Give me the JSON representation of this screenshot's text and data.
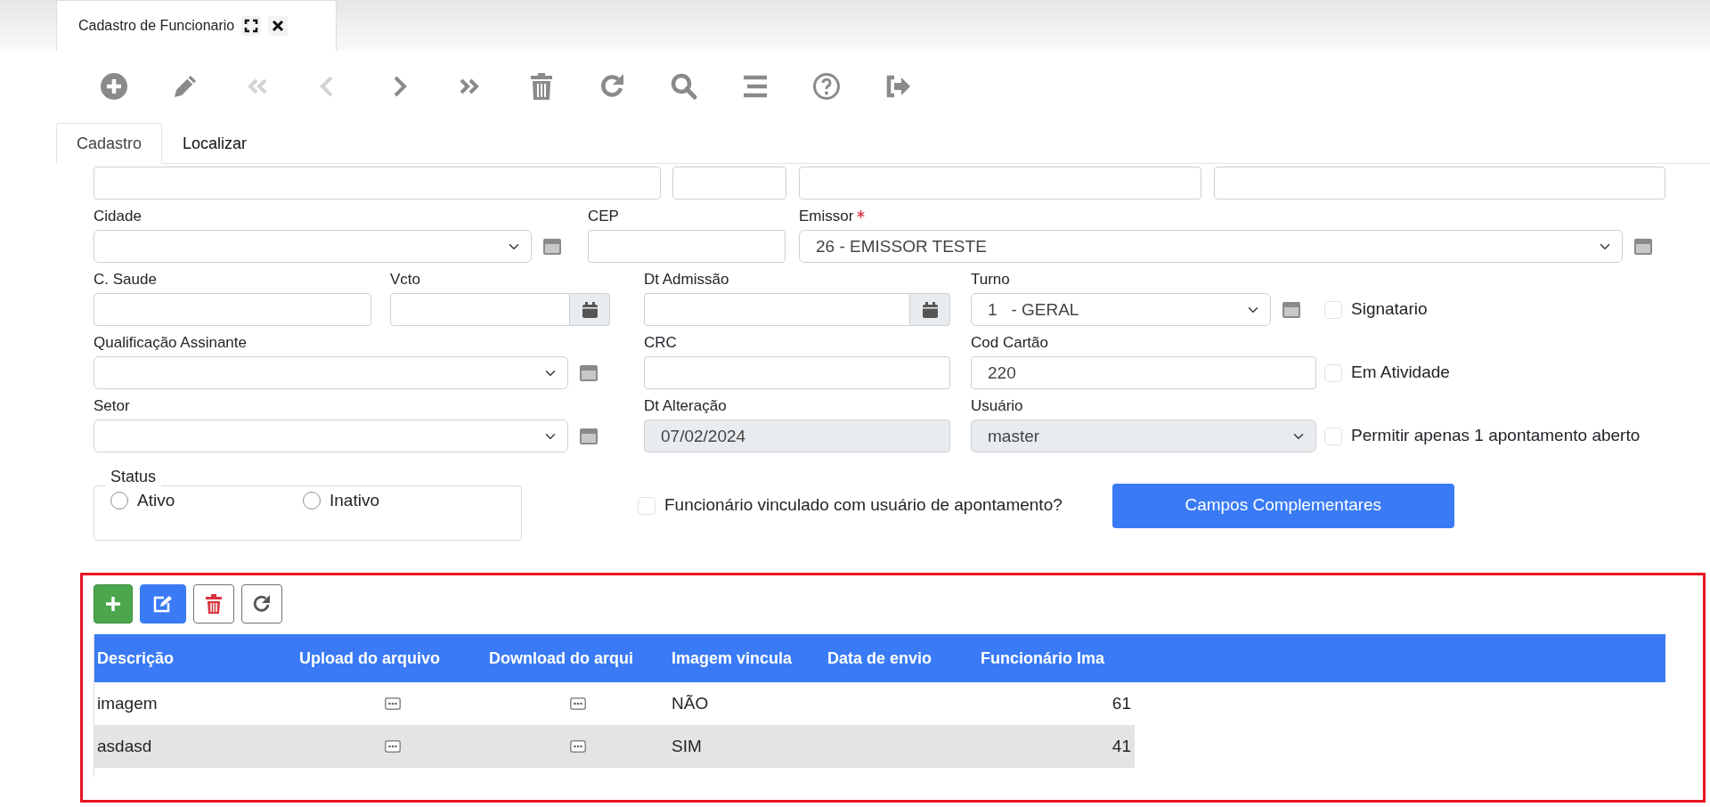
{
  "window_tab": {
    "title": "Cadastro de Funcionario"
  },
  "toolbar": [
    {
      "disabled": false
    },
    {
      "disabled": false
    },
    {
      "disabled": true
    },
    {
      "disabled": true
    },
    {
      "disabled": false
    },
    {
      "disabled": false
    },
    {
      "disabled": false
    },
    {
      "disabled": false
    },
    {
      "disabled": false
    },
    {
      "disabled": false
    },
    {
      "disabled": false
    },
    {
      "disabled": false
    }
  ],
  "tabs": [
    {
      "label": "Cadastro",
      "selected": true
    },
    {
      "label": "Localizar",
      "selected": false
    }
  ],
  "form_rows": [
    {
      "fields": [
        {
          "kind": "text",
          "disabled": false
        },
        {
          "kind": "text",
          "disabled": false
        },
        {
          "kind": "text",
          "disabled": false
        },
        {
          "kind": "text",
          "disabled": false
        }
      ]
    },
    {
      "fields": [
        {
          "kind": "select",
          "label": "Cidade",
          "required": false,
          "lookup": true,
          "disabled": false
        },
        {
          "kind": "text",
          "label": "CEP",
          "required": false,
          "disabled": false
        },
        {
          "kind": "select",
          "label": "Emissor",
          "required": true,
          "value": "26 - EMISSOR TESTE",
          "lookup": true,
          "disabled": false
        }
      ]
    },
    {
      "fields": [
        {
          "kind": "text",
          "label": "C. Saude",
          "required": false,
          "disabled": false
        },
        {
          "kind": "date",
          "label": "Vcto",
          "required": false,
          "disabled": false
        },
        {
          "kind": "date",
          "label": "Dt Admissão",
          "required": false,
          "disabled": false
        },
        {
          "kind": "select",
          "label": "Turno",
          "required": false,
          "value": "1   - GERAL",
          "lookup": true,
          "disabled": false
        },
        {
          "kind": "checkbox",
          "label": "Signatario",
          "checked": false
        }
      ]
    },
    {
      "fields": [
        {
          "kind": "select",
          "label": "Qualificação Assinante",
          "required": false,
          "lookup": true,
          "disabled": false
        },
        {
          "kind": "text",
          "label": "CRC",
          "required": false,
          "disabled": false
        },
        {
          "kind": "text",
          "label": "Cod Cartão",
          "required": false,
          "value": "220",
          "disabled": false
        },
        {
          "kind": "checkbox",
          "label": "Em Atividade",
          "checked": false
        }
      ]
    },
    {
      "fields": [
        {
          "kind": "select",
          "label": "Setor",
          "required": false,
          "lookup": true,
          "disabled": false
        },
        {
          "kind": "text",
          "label": "Dt Alteração",
          "required": false,
          "value": "07/02/2024",
          "disabled": true
        },
        {
          "kind": "select",
          "label": "Usuário",
          "required": false,
          "value": "master",
          "lookup": false,
          "disabled": true
        },
        {
          "kind": "checkbox",
          "label": "Permitir apenas 1 apontamento aberto",
          "checked": false
        }
      ]
    }
  ],
  "status": {
    "legend": "Status",
    "options": [
      {
        "label": "Ativo",
        "selected": false
      },
      {
        "label": "Inativo",
        "selected": false
      }
    ]
  },
  "linked_user": {
    "label": "Funcionário vinculado com usuário de apontamento?",
    "checked": false
  },
  "complement_button": "Campos Complementares",
  "grid": {
    "columns": [
      "Descrição",
      "Upload do arquivo",
      "Download do arqui",
      "Imagem vincula",
      "Data de envio",
      "Funcionário Ima"
    ],
    "rows": [
      {
        "descricao": "imagem",
        "column_4": "NÃO",
        "column_6": "61",
        "selected": false
      },
      {
        "descricao": "asdasd",
        "column_4": "SIM",
        "column_6": "41",
        "selected": true
      }
    ]
  }
}
